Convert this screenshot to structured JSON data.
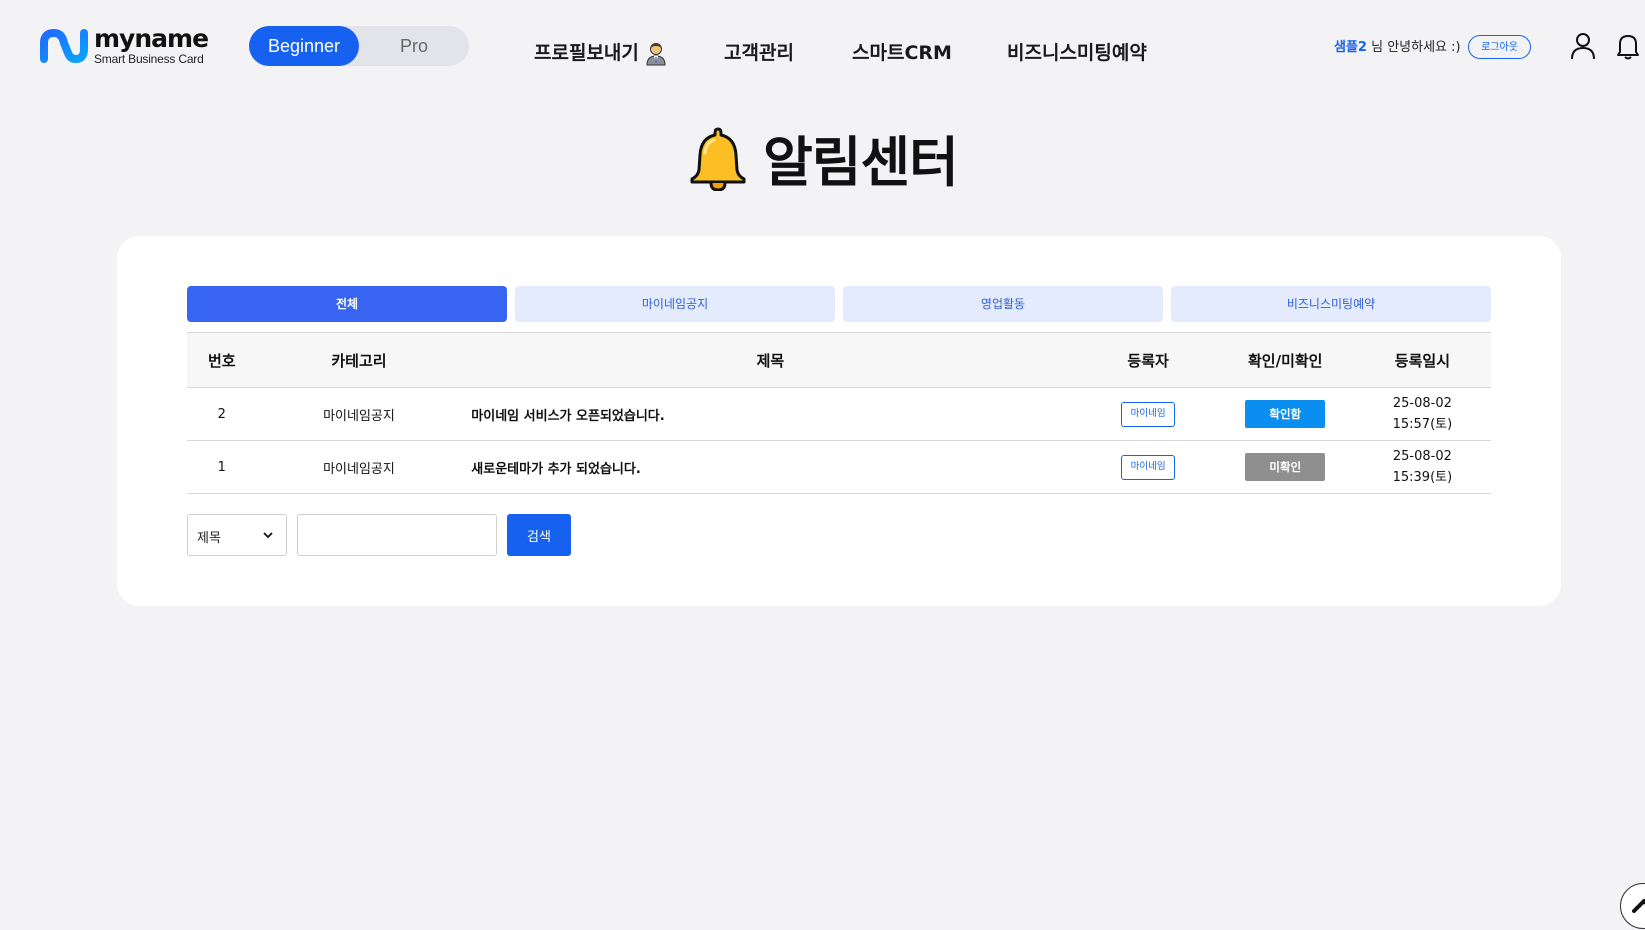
{
  "brand": {
    "name": "myname",
    "tagline": "Smart Business Card",
    "primary_color": "#1761f0"
  },
  "plan_toggle": {
    "options": [
      "Beginner",
      "Pro"
    ],
    "selected": "Beginner"
  },
  "nav": {
    "items": [
      "프로필보내기",
      "고객관리",
      "스마트CRM",
      "비즈니스미팅예약"
    ]
  },
  "user": {
    "name": "샘플2",
    "greeting": " 님 안녕하세요 :)",
    "logout_label": "로그아웃"
  },
  "icons": {
    "profile": "person-icon",
    "notifications": "bell-icon",
    "scroll_top": "chevron-up-icon"
  },
  "page": {
    "title": "알림센터"
  },
  "tabs": [
    {
      "label": "전체",
      "active": true
    },
    {
      "label": "마이네임공지",
      "active": false
    },
    {
      "label": "영업활동",
      "active": false
    },
    {
      "label": "비즈니스미팅예약",
      "active": false
    }
  ],
  "table": {
    "headers": [
      "번호",
      "카테고리",
      "제목",
      "등록자",
      "확인/미확인",
      "등록일시"
    ],
    "rows": [
      {
        "no": "2",
        "category": "마이네임공지",
        "title": "마이네임 서비스가 오픈되었습니다.",
        "writer": "마이네임",
        "status": "확인함",
        "date": "25-08-02",
        "time": "15:57(토)"
      },
      {
        "no": "1",
        "category": "마이네임공지",
        "title": "새로운테마가 추가 되었습니다.",
        "writer": "마이네임",
        "status": "미확인",
        "date": "25-08-02",
        "time": "15:39(토)"
      }
    ]
  },
  "search": {
    "field_options_selected": "제목",
    "input_value": "",
    "button_label": "검색"
  }
}
